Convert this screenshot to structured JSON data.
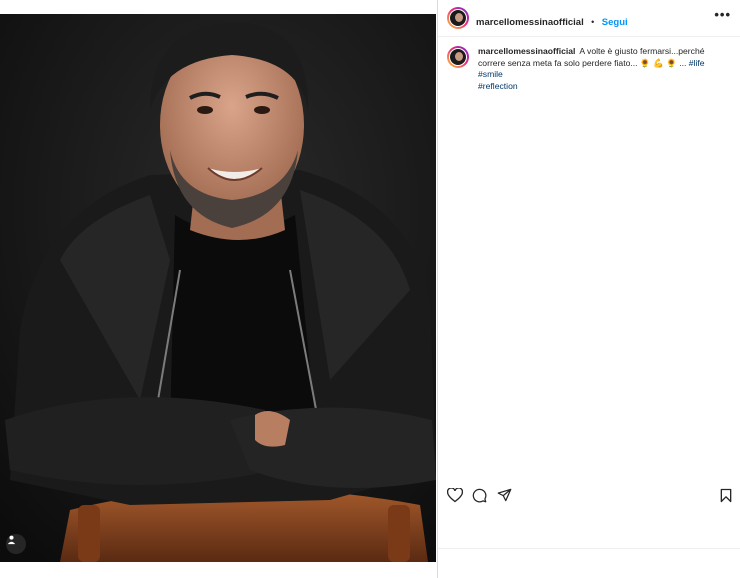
{
  "post": {
    "username": "marcellomessinaofficial",
    "separator": "•",
    "follow_label": "Segui",
    "more_label": "•••",
    "caption": {
      "username": "marcellomessinaofficial",
      "text": "A volte è giusto fermarsi...perché correre senza meta fa solo perdere fiato... 🌻 💪 🌻 ...",
      "hashtags": [
        "#life",
        "#smile",
        "#reflection"
      ]
    }
  },
  "icons": {
    "like": "heart-icon",
    "comment": "comment-icon",
    "share": "paper-plane-icon",
    "save": "bookmark-icon",
    "tagged": "user-tag-icon",
    "more": "more-options-icon"
  },
  "colors": {
    "link": "#0095f6",
    "hashtag": "#00376b",
    "photo_background": "#121212"
  }
}
